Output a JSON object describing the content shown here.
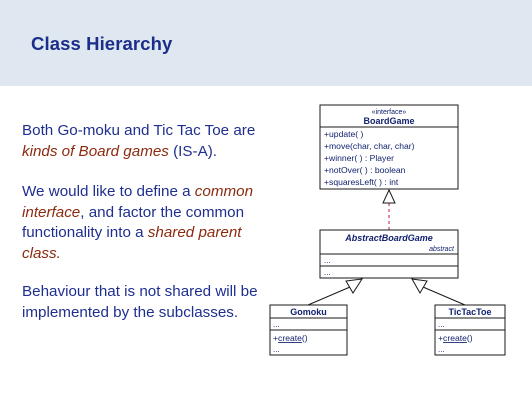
{
  "slide": {
    "title": "Class Hierarchy"
  },
  "text": {
    "p1_a": "Both Go-moku and Tic Tac Toe are ",
    "p1_em": "kinds of Board games",
    "p1_b": " (IS-A).",
    "p2_a": "We would like to define a ",
    "p2_em1": "common interface",
    "p2_b": ", and factor the common functionality into a ",
    "p2_em2": "shared parent class.",
    "p3": "Behaviour that is not shared will be implemented by the subclasses."
  },
  "uml": {
    "board_game": {
      "stereotype": "«interface»",
      "name": "BoardGame",
      "methods": [
        "+update( )",
        "+move(char, char, char)",
        "+winner( ) : Player",
        "+notOver( ) : boolean",
        "+squaresLeft( ) : int"
      ]
    },
    "abstract_board_game": {
      "name": "AbstractBoardGame",
      "modifier": "abstract",
      "attributes": "...",
      "methods": "..."
    },
    "gomoku": {
      "name": "Gomoku",
      "attributes": "...",
      "method_prefix": "+",
      "method_name": "create",
      "method_suffix": "()",
      "more": "..."
    },
    "tictactoe": {
      "name": "TicTacToe",
      "attributes": "...",
      "method_prefix": "+",
      "method_name": "create",
      "method_suffix": "()",
      "more": "..."
    }
  },
  "colors": {
    "title_band": "#dfe7f1",
    "title_text": "#1a2e8a",
    "body_text": "#1f2f8f",
    "emphasis": "#8c2a0f",
    "uml_line": "#1a1a1a",
    "uml_text": "#12226e",
    "realization_line": "#d04060"
  }
}
